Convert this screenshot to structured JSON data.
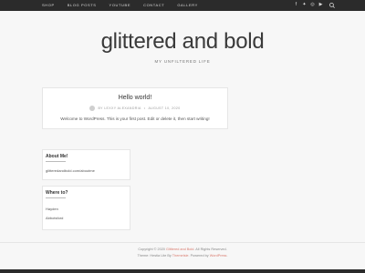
{
  "nav": {
    "items": [
      {
        "label": "Shop"
      },
      {
        "label": "Blog Posts"
      },
      {
        "label": "Youtube"
      },
      {
        "label": "Contact"
      },
      {
        "label": "Gallery"
      }
    ],
    "social_icons": [
      "facebook-icon",
      "twitter-icon",
      "instagram-icon",
      "youtube-icon"
    ],
    "search_icon": "search-icon"
  },
  "header": {
    "site_title": "glittered and bold",
    "tagline": "MY UNFILTERED LIFE"
  },
  "post": {
    "title": "Hello world!",
    "author": "BY LEXXY ALEXANDRIA",
    "date": "AUGUST 10, 2020",
    "excerpt": "Welcome to WordPress. This is your first post. Edit or delete it, then start writing!"
  },
  "widgets": {
    "about": {
      "title": "About Me!",
      "text": "glitteredandbold.com/aboutme"
    },
    "where": {
      "title": "Where to?",
      "links": [
        "Hayden",
        "Abbotsford"
      ]
    }
  },
  "footer": {
    "copyright_prefix": "Copyright © 2020 ",
    "site_link": "Glittered and Bold",
    "rights": ". All Rights Reserved.",
    "theme_prefix": "Theme: Hestia Lite By ",
    "theme_author": "ThemeIsle",
    "powered_prefix": ". Powered by ",
    "powered_link": "WordPress",
    "powered_suffix": "."
  },
  "colors": {
    "topbar": "#2b2b2b",
    "background": "#f7f7f7",
    "accent": "#d97b6f"
  }
}
